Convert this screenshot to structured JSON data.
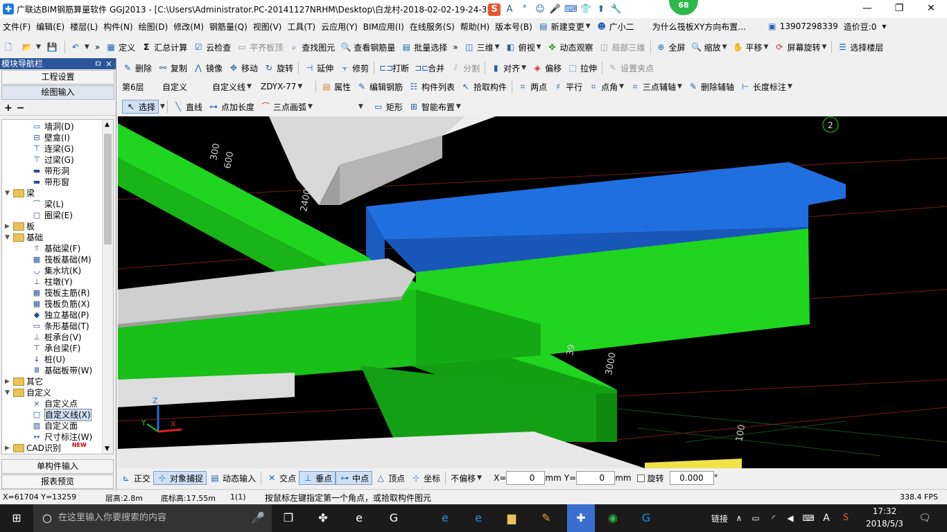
{
  "window": {
    "title": "广联达BIM钢筋算量软件 GGJ2013 - [C:\\Users\\Administrator.PC-20141127NRHM\\Desktop\\白龙村-2018-02-02-19-24-35",
    "badge": "68",
    "controls": {
      "minimize": "—",
      "maximize": "❐",
      "close": "✕"
    }
  },
  "ime_icons": [
    "S",
    "A",
    "°",
    "☺",
    "🎤",
    "⌨",
    "👕",
    "⬆",
    "🔧"
  ],
  "menu": [
    "文件(F)",
    "编辑(E)",
    "楼层(L)",
    "构件(N)",
    "绘图(D)",
    "修改(M)",
    "钢筋量(Q)",
    "视图(V)",
    "工具(T)",
    "云应用(Y)",
    "BIM应用(I)",
    "在线服务(S)",
    "帮助(H)",
    "版本号(B)"
  ],
  "menu_right": {
    "new_change": "新建变更",
    "assistant": "广小二",
    "question": "为什么筏板XY方向布置...",
    "phone": "13907298339",
    "coins": "造价豆:0"
  },
  "toolbar1": {
    "define": "定义",
    "sum_calc": "汇总计算",
    "cloud_check": "云检查",
    "level_slab": "平齐板顶",
    "find_element": "查找图元",
    "view_rebar": "查看钢筋量",
    "batch_select": "批量选择",
    "view3d": "三维",
    "top_view": "俯视",
    "dynamic_view": "动态观察",
    "local3d": "局部三维",
    "fullscreen": "全屏",
    "zoom": "缩放",
    "pan": "平移",
    "screen_rotate": "屏幕旋转",
    "select_floor": "选择楼层"
  },
  "nav": {
    "title": "模块导航栏",
    "pin": "ㅁ",
    "close": "×",
    "project_settings": "工程设置",
    "drawing_input": "绘图输入",
    "single_input": "单构件输入",
    "report_preview": "报表预览",
    "tree": [
      {
        "label": "墙洞(D)",
        "level": 2
      },
      {
        "label": "壁龛(I)",
        "level": 2
      },
      {
        "label": "连梁(G)",
        "level": 2
      },
      {
        "label": "过梁(G)",
        "level": 2
      },
      {
        "label": "带形洞",
        "level": 2
      },
      {
        "label": "带形窗",
        "level": 2
      },
      {
        "label": "梁",
        "level": 1
      },
      {
        "label": "梁(L)",
        "level": 2
      },
      {
        "label": "圈梁(E)",
        "level": 2
      },
      {
        "label": "板",
        "level": 1
      },
      {
        "label": "基础",
        "level": 1
      },
      {
        "label": "基础梁(F)",
        "level": 2
      },
      {
        "label": "筏板基础(M)",
        "level": 2
      },
      {
        "label": "集水坑(K)",
        "level": 2
      },
      {
        "label": "柱墩(Y)",
        "level": 2
      },
      {
        "label": "筏板主筋(R)",
        "level": 2
      },
      {
        "label": "筏板负筋(X)",
        "level": 2
      },
      {
        "label": "独立基础(P)",
        "level": 2
      },
      {
        "label": "条形基础(T)",
        "level": 2
      },
      {
        "label": "桩承台(V)",
        "level": 2
      },
      {
        "label": "承台梁(F)",
        "level": 2
      },
      {
        "label": "桩(U)",
        "level": 2
      },
      {
        "label": "基础板带(W)",
        "level": 2
      },
      {
        "label": "其它",
        "level": 1
      },
      {
        "label": "自定义",
        "level": 1
      },
      {
        "label": "自定义点",
        "level": 2
      },
      {
        "label": "自定义线(X)",
        "level": 2
      },
      {
        "label": "自定义面",
        "level": 2
      },
      {
        "label": "尺寸标注(W)",
        "level": 2
      },
      {
        "label": "CAD识别",
        "level": 1
      }
    ],
    "new_badge": "NEW"
  },
  "toolbar2": {
    "delete": "删除",
    "copy": "复制",
    "mirror": "镜像",
    "move": "移动",
    "rotate": "旋转",
    "extend": "延伸",
    "trim": "修剪",
    "break": "打断",
    "merge": "合并",
    "split": "分割",
    "align": "对齐",
    "offset": "偏移",
    "stretch": "拉伸",
    "set_grip": "设置夹点"
  },
  "toolbar3": {
    "floor": "第6层",
    "custom": "自定义",
    "custom_line": "自定义线",
    "element": "ZDYX-77",
    "props": "属性",
    "edit_rebar": "编辑钢筋",
    "element_list": "构件列表",
    "pick_element": "拾取构件",
    "two_points": "两点",
    "parallel": "平行",
    "point_angle": "点角",
    "three_point_axis": "三点辅轴",
    "delete_axis": "删除辅轴",
    "length_dim": "长度标注"
  },
  "toolbar4": {
    "select": "选择",
    "line": "直线",
    "point_length": "点加长度",
    "three_arc": "三点画弧",
    "rect": "矩形",
    "smart_layout": "智能布置"
  },
  "viewport": {
    "dims": [
      "300",
      "600",
      "2400",
      "3000",
      "39",
      "100"
    ],
    "axis_badge": "2",
    "axis_labels": {
      "z": "Z",
      "x": "X",
      "y": "Y"
    },
    "colors": {
      "green": "#1fd51f",
      "blue": "#1f6fe0",
      "gray": "#c9c9c9",
      "bg": "#000000"
    }
  },
  "snapbar": {
    "ortho": "正交",
    "snap": "对象捕捉",
    "dyn_input": "动态输入",
    "intersect": "交点",
    "perpendicular": "垂点",
    "midpoint": "中点",
    "vertex": "顶点",
    "coord": "坐标",
    "no_offset": "不偏移",
    "x_label": "X=",
    "x_val": "0",
    "y_label": "Y=",
    "y_val": "0",
    "unit": "mm",
    "rotate": "旋转",
    "rot_val": "0.000",
    "deg": "°"
  },
  "status": {
    "coords": "X=61704 Y=13259",
    "floor_height": "层高:2.8m",
    "base_height": "底标高:17.55m",
    "count": "1(1)",
    "hint": "按鼠标左键指定第一个角点，或拾取构件图元",
    "fps": "338.4 FPS"
  },
  "taskbar": {
    "search": "在这里输入你要搜索的内容",
    "link": "链接",
    "ime": "A",
    "time": "17:32",
    "date": "2018/5/3"
  }
}
